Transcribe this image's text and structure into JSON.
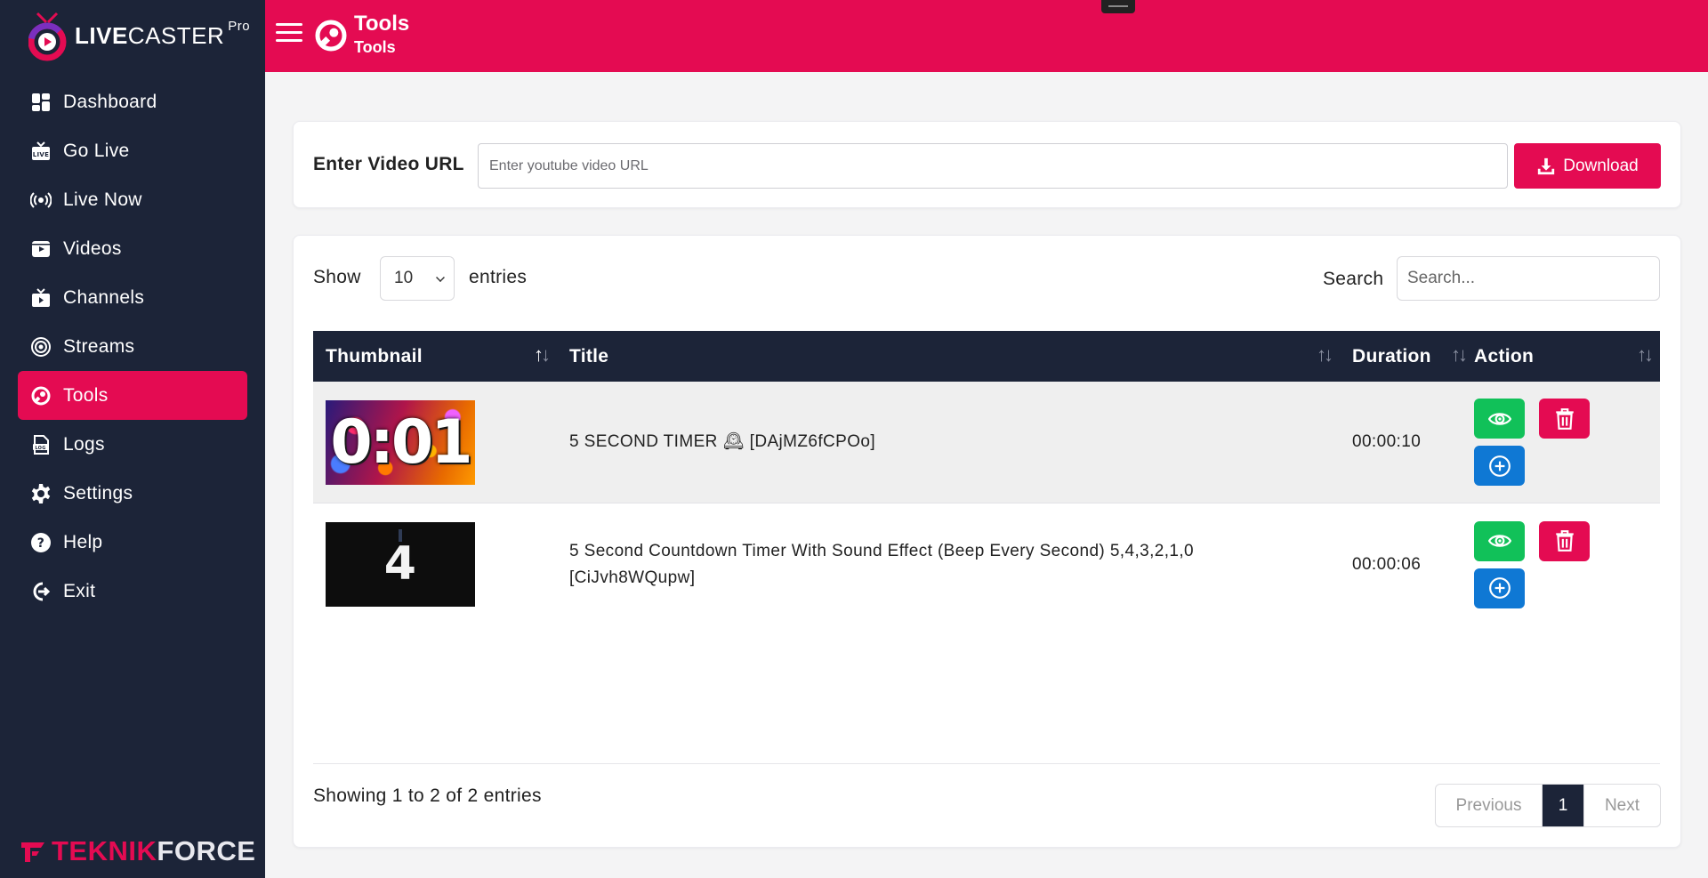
{
  "app": {
    "logo_bold": "LIVE",
    "logo_light": "CASTER",
    "logo_suffix": "Pro",
    "footer_brand_red": "TEKNIK",
    "footer_brand_white": "FORCE",
    "accent_color": "#e40b52",
    "sidebar_color": "#1c2438"
  },
  "sidebar": {
    "items": [
      {
        "label": "Dashboard",
        "icon": "dashboard-icon"
      },
      {
        "label": "Go Live",
        "icon": "live-tv-icon"
      },
      {
        "label": "Live Now",
        "icon": "broadcast-icon"
      },
      {
        "label": "Videos",
        "icon": "video-icon"
      },
      {
        "label": "Channels",
        "icon": "tv-icon"
      },
      {
        "label": "Streams",
        "icon": "streams-icon"
      },
      {
        "label": "Tools",
        "icon": "tools-icon",
        "active": true
      },
      {
        "label": "Logs",
        "icon": "logs-icon"
      },
      {
        "label": "Settings",
        "icon": "gear-icon"
      },
      {
        "label": "Help",
        "icon": "help-icon"
      },
      {
        "label": "Exit",
        "icon": "exit-icon"
      }
    ]
  },
  "header": {
    "title": "Tools",
    "subtitle": "Tools"
  },
  "downloader": {
    "label": "Enter Video URL",
    "placeholder": "Enter youtube video URL",
    "value": "",
    "button_label": "Download"
  },
  "table_controls": {
    "show_label": "Show",
    "entries_value": "10",
    "entries_label": "entries",
    "search_label": "Search",
    "search_placeholder": "Search..."
  },
  "table": {
    "columns": [
      "Thumbnail",
      "Title",
      "Duration",
      "Action"
    ],
    "rows": [
      {
        "thumb_text": "0:01",
        "title": "5 SECOND TIMER 🕰 [DAjMZ6fCPOo]",
        "duration": "00:00:10"
      },
      {
        "thumb_text": "4",
        "title": "5 Second Countdown Timer With Sound Effect (Beep Every Second) 5,4,3,2,1,0 [CiJvh8WQupw]",
        "duration": "00:00:06"
      }
    ]
  },
  "footer": {
    "info": "Showing 1 to 2 of 2 entries",
    "prev_label": "Previous",
    "current_page": "1",
    "next_label": "Next"
  }
}
